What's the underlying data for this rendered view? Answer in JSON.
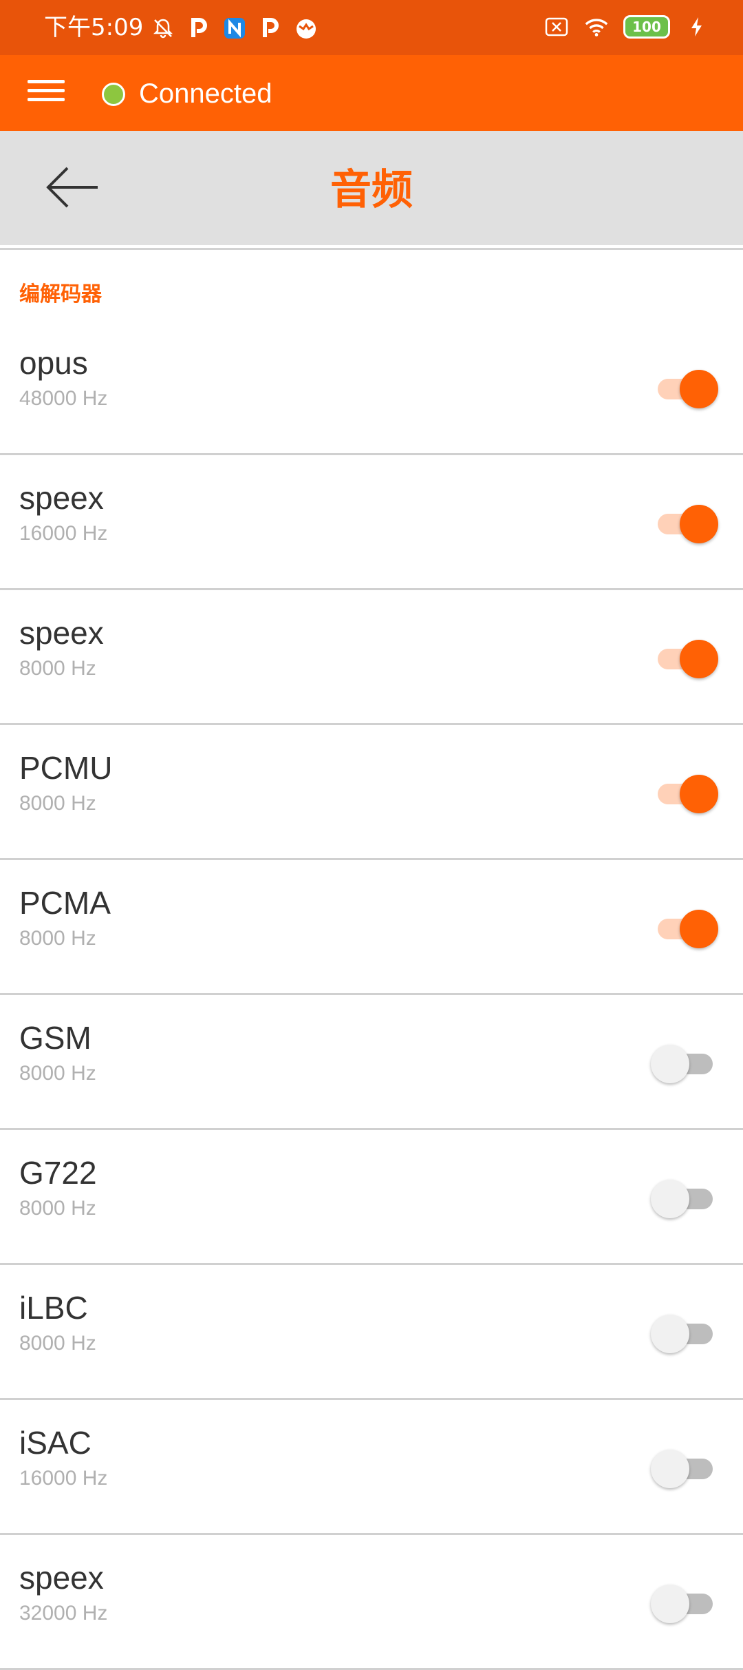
{
  "status_bar": {
    "time": "下午5:09",
    "battery": "100",
    "icons": [
      "notification-muted-icon",
      "p-app-icon",
      "n-app-icon",
      "p-app-icon",
      "game-app-icon",
      "sim-off-icon",
      "wifi-icon",
      "battery-icon",
      "charging-icon"
    ]
  },
  "app_bar": {
    "connection_status": "Connected",
    "status_color": "#8DC63F",
    "accent": "#FF6105"
  },
  "title_bar": {
    "title": "音频"
  },
  "section": {
    "header": "编解码器"
  },
  "codecs": [
    {
      "name": "opus",
      "rate": "48000 Hz",
      "enabled": true
    },
    {
      "name": "speex",
      "rate": "16000 Hz",
      "enabled": true
    },
    {
      "name": "speex",
      "rate": "8000 Hz",
      "enabled": true
    },
    {
      "name": "PCMU",
      "rate": "8000 Hz",
      "enabled": true
    },
    {
      "name": "PCMA",
      "rate": "8000 Hz",
      "enabled": true
    },
    {
      "name": "GSM",
      "rate": "8000 Hz",
      "enabled": false
    },
    {
      "name": "G722",
      "rate": "8000 Hz",
      "enabled": false
    },
    {
      "name": "iLBC",
      "rate": "8000 Hz",
      "enabled": false
    },
    {
      "name": "iSAC",
      "rate": "16000 Hz",
      "enabled": false
    },
    {
      "name": "speex",
      "rate": "32000 Hz",
      "enabled": false
    }
  ]
}
